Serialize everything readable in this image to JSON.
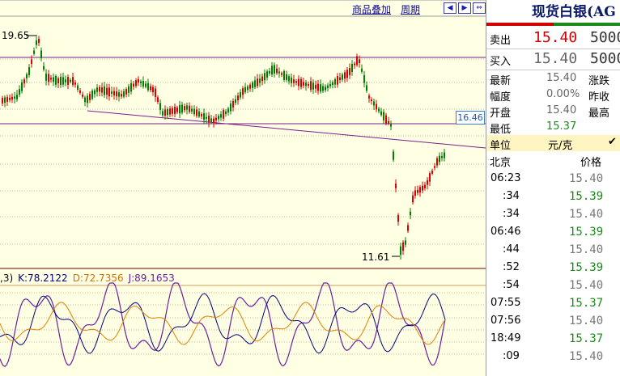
{
  "toolbar": {
    "overlay_label": "商品叠加",
    "period_label": "周期",
    "nav_icons": [
      "arrow-left-icon",
      "arrow-right-icon",
      "arrow-expand-icon"
    ]
  },
  "price_chart": {
    "high_label": "19.65",
    "low_label": "11.61",
    "current_price_tag": "16.46",
    "kdj_prefix": ",3)",
    "k_label": "K:78.2122",
    "d_label": "D:72.7356",
    "j_label": "J:89.1653"
  },
  "colors": {
    "up": "#dd0000",
    "down": "#008000",
    "k_line": "#000080",
    "d_line": "#e08000",
    "j_line": "#6a1fa0",
    "trend_line": "#7a1f8a",
    "background": "#ffffe4"
  },
  "panel": {
    "title": "现货白银(AG",
    "sell": {
      "label": "卖出",
      "price": "15.40",
      "volume": "5000"
    },
    "buy": {
      "label": "买入",
      "price": "15.40",
      "volume": "5000"
    },
    "stats": [
      {
        "label": "最新",
        "value": "15.40",
        "label2": "涨跌"
      },
      {
        "label": "幅度",
        "value": "0.00%",
        "label2": "昨收"
      },
      {
        "label": "开盘",
        "value": "15.40",
        "label2": "最高"
      },
      {
        "label": "最低",
        "value": "15.37",
        "label2": ""
      }
    ],
    "unit_label": "单位",
    "unit_value": "元/克",
    "ticks_header": {
      "time": "北京",
      "price": "价格"
    },
    "ticks": [
      {
        "time": "06:23",
        "price": "15.40",
        "dir": "flat"
      },
      {
        "time": ":34",
        "price": "15.39",
        "dir": "down"
      },
      {
        "time": ":34",
        "price": "15.40",
        "dir": "flat"
      },
      {
        "time": "06:46",
        "price": "15.39",
        "dir": "down"
      },
      {
        "time": ":44",
        "price": "15.40",
        "dir": "flat"
      },
      {
        "time": ":52",
        "price": "15.39",
        "dir": "down"
      },
      {
        "time": ":54",
        "price": "15.40",
        "dir": "flat"
      },
      {
        "time": "07:55",
        "price": "15.37",
        "dir": "down"
      },
      {
        "time": "07:56",
        "price": "15.40",
        "dir": "flat"
      },
      {
        "time": "18:49",
        "price": "15.37",
        "dir": "down"
      },
      {
        "time": ":09",
        "price": "15.40",
        "dir": "flat"
      }
    ]
  }
}
